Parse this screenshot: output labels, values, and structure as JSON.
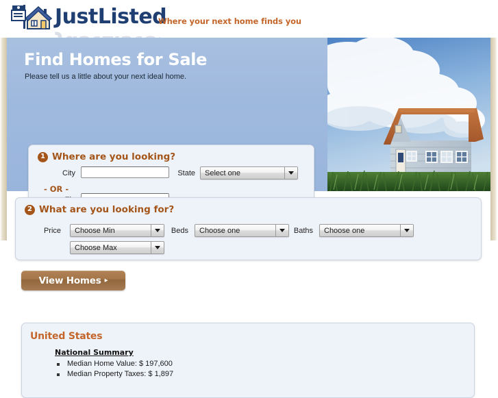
{
  "header": {
    "logo_text": "JustListed",
    "logo_icon": "for-sale-sign-house-icon",
    "tagline": "Where your next home finds you"
  },
  "hero": {
    "title": "Find Homes for Sale",
    "subtitle": "Please tell us a little about your next ideal home.",
    "photo_alt": "house-on-grass-with-clouds-photo"
  },
  "step1": {
    "number": "1",
    "heading": "Where are you looking?",
    "city_label": "City",
    "city_value": "",
    "city_placeholder": "",
    "or_label": "- OR -",
    "zip_label": "Zip",
    "zip_value": "",
    "zip_placeholder": "",
    "state_label": "State",
    "state_value": "Select one"
  },
  "step2": {
    "number": "2",
    "heading": "What are you looking for?",
    "price_label": "Price",
    "price_min_value": "Choose Min",
    "price_max_value": "Choose Max",
    "beds_label": "Beds",
    "beds_value": "Choose one",
    "baths_label": "Baths",
    "baths_value": "Choose one"
  },
  "submit": {
    "label": "View Homes",
    "arrow": "▸"
  },
  "national": {
    "region_title": "United States",
    "summary_title": "National Summary",
    "items": [
      "Median Home Value: $ 197,600",
      "Median Property Taxes: $ 1,897"
    ]
  },
  "colors": {
    "brand_blue": "#1f3f73",
    "accent_orange": "#c4662a",
    "step_brown": "#a4561a",
    "hero_blue": "#9fb9de",
    "panel_bg": "#eef2f9",
    "button_brown": "#a4764a"
  }
}
